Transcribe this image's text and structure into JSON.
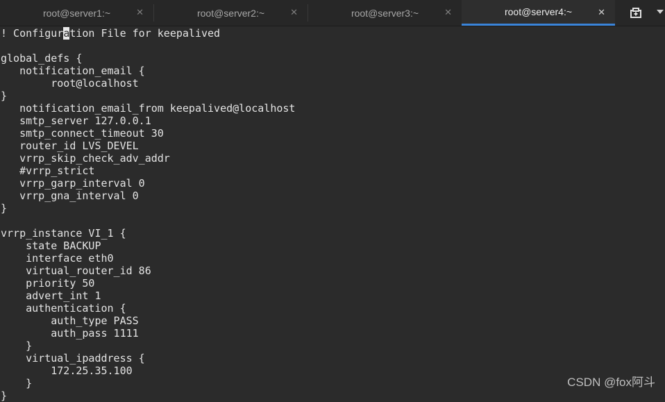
{
  "tabs": [
    {
      "label": "root@server1:~",
      "active": false
    },
    {
      "label": "root@server2:~",
      "active": false
    },
    {
      "label": "root@server3:~",
      "active": false
    },
    {
      "label": "root@server4:~",
      "active": true
    }
  ],
  "icons": {
    "tab_close": "close-icon",
    "new_tab": "new-tab-icon",
    "menu": "chevron-down-icon"
  },
  "colors": {
    "active_tab_indicator": "#3a84d9",
    "terminal_bg": "#2b2b2b",
    "terminal_fg": "#e4e4e4"
  },
  "terminal": {
    "first_line_before_cursor": "! Configur",
    "cursor_char": "a",
    "first_line_after_cursor": "tion File for keepalived",
    "lines": [
      "",
      "global_defs {",
      "   notification_email {",
      "        root@localhost",
      "}",
      "   notification_email_from keepalived@localhost",
      "   smtp_server 127.0.0.1",
      "   smtp_connect_timeout 30",
      "   router_id LVS_DEVEL",
      "   vrrp_skip_check_adv_addr",
      "   #vrrp_strict",
      "   vrrp_garp_interval 0",
      "   vrrp_gna_interval 0",
      "}",
      "",
      "vrrp_instance VI_1 {",
      "    state BACKUP",
      "    interface eth0",
      "    virtual_router_id 86",
      "    priority 50",
      "    advert_int 1",
      "    authentication {",
      "        auth_type PASS",
      "        auth_pass 1111",
      "    }",
      "    virtual_ipaddress {",
      "        172.25.35.100",
      "    }",
      "}"
    ]
  },
  "watermark": "CSDN @fox阿斗"
}
